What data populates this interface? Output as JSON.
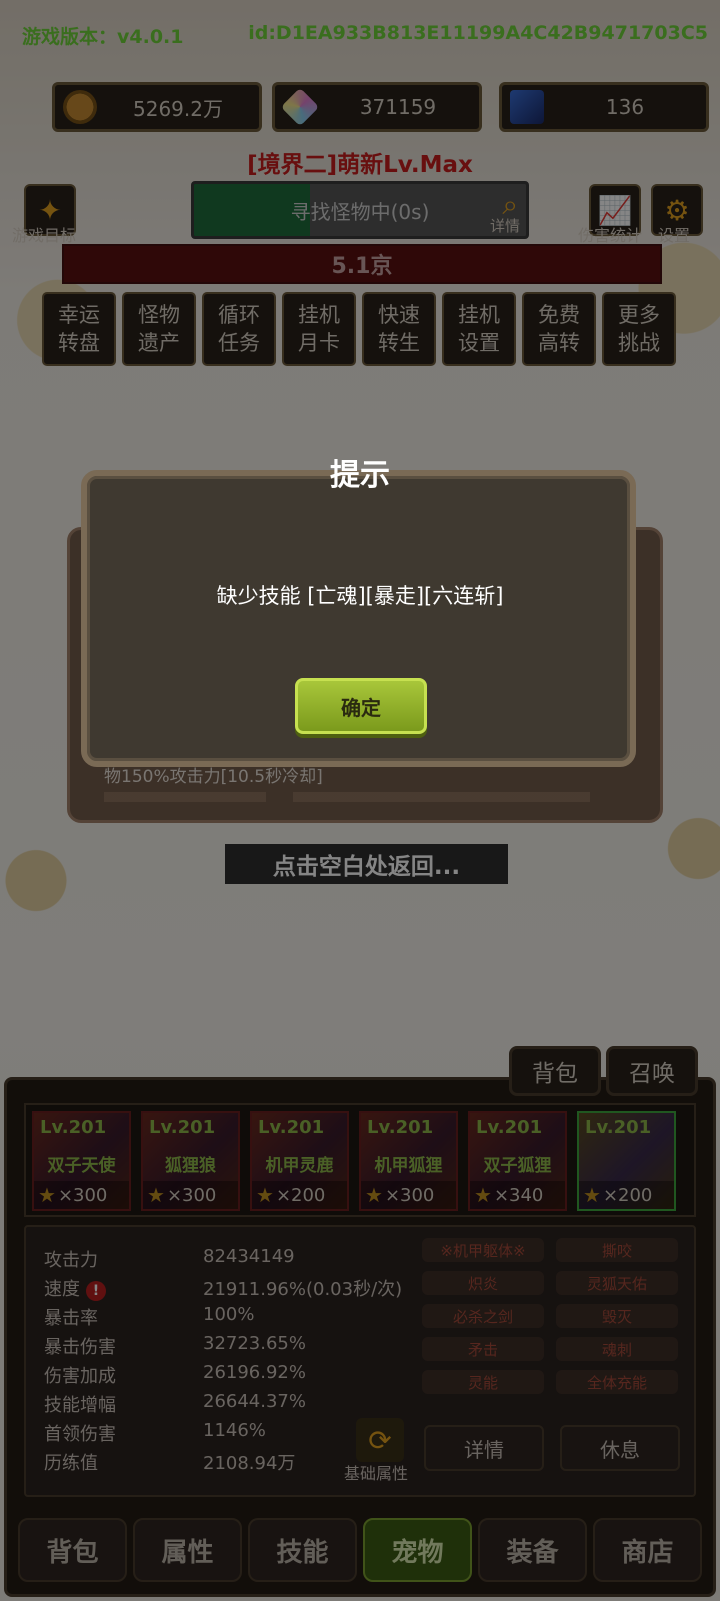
{
  "header": {
    "version": "游戏版本：v4.0.1",
    "device_id": "id:D1EA933B813E11199A4C42B9471703C5"
  },
  "resources": [
    {
      "icon": "coin-icon",
      "value": "5269.2万"
    },
    {
      "icon": "crystal-icon",
      "value": "371159"
    },
    {
      "icon": "card-icon",
      "value": "136"
    }
  ],
  "realm_title": "[境界二]萌新Lv.Max",
  "left_button": {
    "icon": "sparkle-icon",
    "label": "游戏目标"
  },
  "search": {
    "label": "寻找怪物中(0s)",
    "detail": "详情",
    "progress": 0.35
  },
  "right_buttons": [
    {
      "icon": "chart-icon",
      "label": "伤害统计"
    },
    {
      "icon": "gear-icon",
      "label": "设置"
    }
  ],
  "boss_hp": "5.1京",
  "features": [
    "幸运转盘",
    "怪物遗产",
    "循环任务",
    "挂机月卡",
    "快速转生",
    "挂机设置",
    "免费高转",
    "更多挑战"
  ],
  "underlying_text": "物150%攻击力[10.5秒冷却]",
  "dialog": {
    "title": "提示",
    "message": "缺少技能 [亡魂][暴走][六连斩]",
    "ok": "确定"
  },
  "back_hint": "点击空白处返回...",
  "bag_tabs": [
    "背包",
    "召唤"
  ],
  "pets": [
    {
      "level": "Lv.201",
      "name": "双子天使",
      "stars": "×300",
      "selected": false
    },
    {
      "level": "Lv.201",
      "name": "狐狸狼",
      "stars": "×300",
      "selected": false
    },
    {
      "level": "Lv.201",
      "name": "机甲灵鹿",
      "stars": "×200",
      "selected": false
    },
    {
      "level": "Lv.201",
      "name": "机甲狐狸",
      "stars": "×300",
      "selected": false
    },
    {
      "level": "Lv.201",
      "name": "双子狐狸",
      "stars": "×340",
      "selected": false
    },
    {
      "level": "Lv.201",
      "name": "",
      "stars": "×200",
      "selected": true
    }
  ],
  "stats": [
    {
      "label": "攻击力",
      "value": "82434149"
    },
    {
      "label": "速度",
      "value": "21911.96%(0.03秒/次)"
    },
    {
      "label": "暴击率",
      "value": "100%"
    },
    {
      "label": "暴击伤害",
      "value": "32723.65%"
    },
    {
      "label": "伤害加成",
      "value": "26196.92%"
    },
    {
      "label": "技能增幅",
      "value": "26644.37%"
    },
    {
      "label": "首领伤害",
      "value": "1146%"
    },
    {
      "label": "历练值",
      "value": "2108.94万"
    }
  ],
  "skills": [
    "※机甲躯体※",
    "撕咬",
    "炽炎",
    "灵狐天佑",
    "必杀之剑",
    "毁灭",
    "矛击",
    "魂刺",
    "灵能",
    "全体充能"
  ],
  "actions": {
    "base_attr": "基础属性",
    "detail": "详情",
    "rest": "休息"
  },
  "nav": [
    {
      "label": "背包",
      "active": false
    },
    {
      "label": "属性",
      "active": false
    },
    {
      "label": "技能",
      "active": false
    },
    {
      "label": "宠物",
      "active": true
    },
    {
      "label": "装备",
      "active": false
    },
    {
      "label": "商店",
      "active": false
    }
  ]
}
